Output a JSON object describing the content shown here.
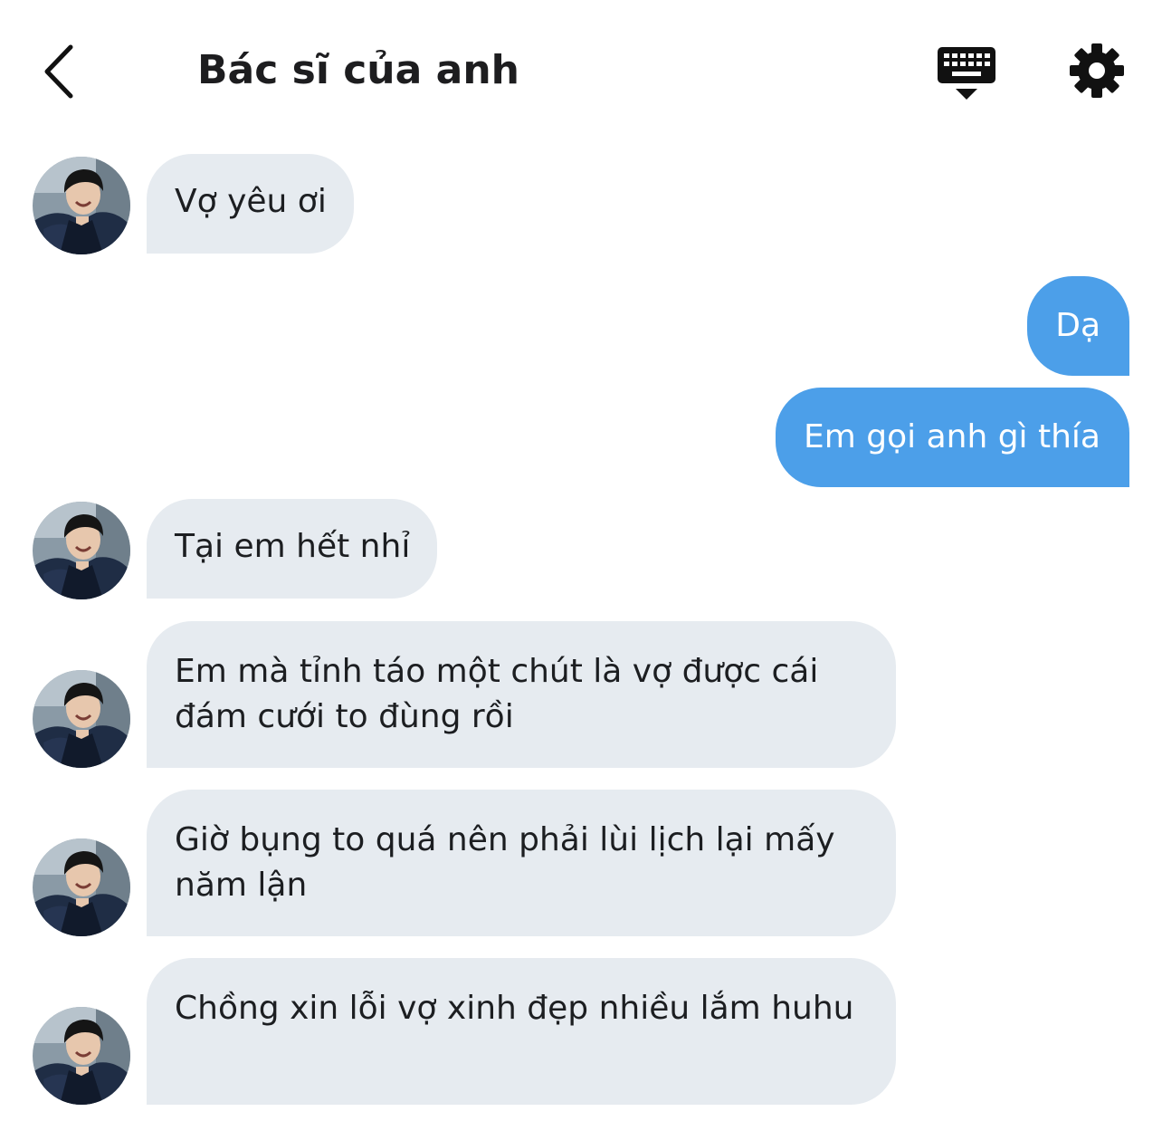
{
  "header": {
    "title": "Bác sĩ của anh",
    "back_icon": "chevron-left-icon",
    "keyboard_icon": "keyboard-icon",
    "settings_icon": "gear-icon"
  },
  "contact": {
    "avatar": "avatar"
  },
  "messages": [
    {
      "direction": "incoming",
      "text": "Vợ yêu ơi"
    },
    {
      "direction": "outgoing",
      "text": "Dạ"
    },
    {
      "direction": "outgoing",
      "text": "Em gọi anh gì thía"
    },
    {
      "direction": "incoming",
      "text": "Tại em hết nhỉ"
    },
    {
      "direction": "incoming",
      "text": "Em mà tỉnh táo một chút là vợ được cái đám cưới to đùng rồi"
    },
    {
      "direction": "incoming",
      "text": "Giờ bụng to quá nên phải lùi lịch lại mấy năm lận"
    },
    {
      "direction": "incoming",
      "text": "Chồng xin lỗi vợ xinh đẹp nhiều lắm huhu"
    }
  ],
  "colors": {
    "incoming_bubble": "#e6ebf0",
    "outgoing_bubble": "#4c9fe9",
    "outgoing_text": "#ffffff",
    "text": "#1c1e21"
  }
}
